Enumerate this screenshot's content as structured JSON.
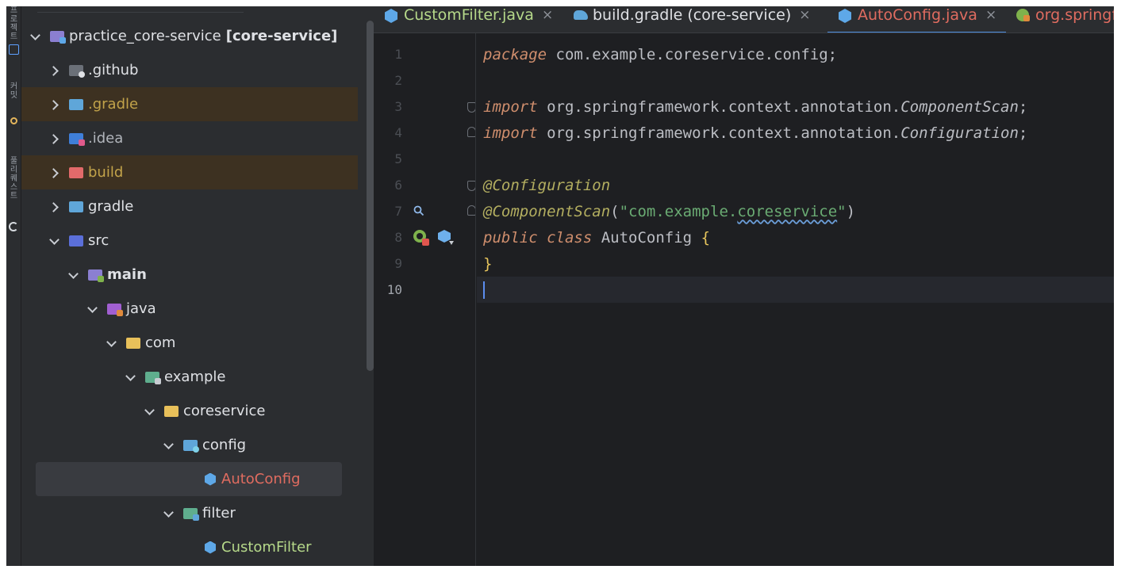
{
  "colors": {
    "accent": "#4d8de0",
    "ignored_folder_bg": "#3d3121",
    "modified_file": "#e06c60",
    "ignored_text": "#c2a34a",
    "new_file": "#b6d98a",
    "keyword": "#cf8e6d",
    "annotation": "#b3ae60",
    "string": "#6aab73"
  },
  "toolstrip": {
    "labels": [
      "프로젝트",
      "커밋",
      "풀 리퀘스트"
    ]
  },
  "tabs": [
    {
      "label": "CustomFilter.java",
      "icon": "java-class-icon",
      "color": "#b6d98a"
    },
    {
      "label": "build.gradle (core-service)",
      "icon": "gradle-icon",
      "color": "#dfe1e5"
    },
    {
      "label": "AutoConfig.java",
      "icon": "java-class-icon",
      "color": "#e06c60"
    },
    {
      "label": "org.springf",
      "icon": "spring-icon",
      "color": "#e06c60"
    }
  ],
  "tab_close": "×",
  "tree": {
    "root": {
      "name": "practice_core-service",
      "module": "[core-service]"
    },
    "items": [
      {
        "label": ".github"
      },
      {
        "label": ".gradle"
      },
      {
        "label": ".idea"
      },
      {
        "label": "build"
      },
      {
        "label": "gradle"
      },
      {
        "label": "src"
      },
      {
        "label": "main"
      },
      {
        "label": "java"
      },
      {
        "label": "com"
      },
      {
        "label": "example"
      },
      {
        "label": "coreservice"
      },
      {
        "label": "config"
      },
      {
        "label": "AutoConfig"
      },
      {
        "label": "filter"
      },
      {
        "label": "CustomFilter"
      }
    ]
  },
  "editor": {
    "line_numbers": [
      "1",
      "2",
      "3",
      "4",
      "5",
      "6",
      "7",
      "8",
      "9",
      "10"
    ],
    "code": {
      "l1": {
        "kw": "package",
        "rest": " com.example.coreservice.config;"
      },
      "l3": {
        "kw": "import",
        "path": " org.springframework.context.annotation.",
        "cls": "ComponentScan",
        "end": ";"
      },
      "l4": {
        "kw": "import",
        "path": " org.springframework.context.annotation.",
        "cls": "Configuration",
        "end": ";"
      },
      "l6": {
        "ann": "@Configuration"
      },
      "l7": {
        "ann": "@ComponentScan",
        "open": "(",
        "str_a": "\"com.example.",
        "str_b": "coreservice",
        "str_c": "\"",
        "close": ")"
      },
      "l8": {
        "kw1": "public",
        "kw2": "class",
        "name": " AutoConfig ",
        "brace": "{"
      },
      "l9": {
        "brace": "}"
      }
    }
  }
}
